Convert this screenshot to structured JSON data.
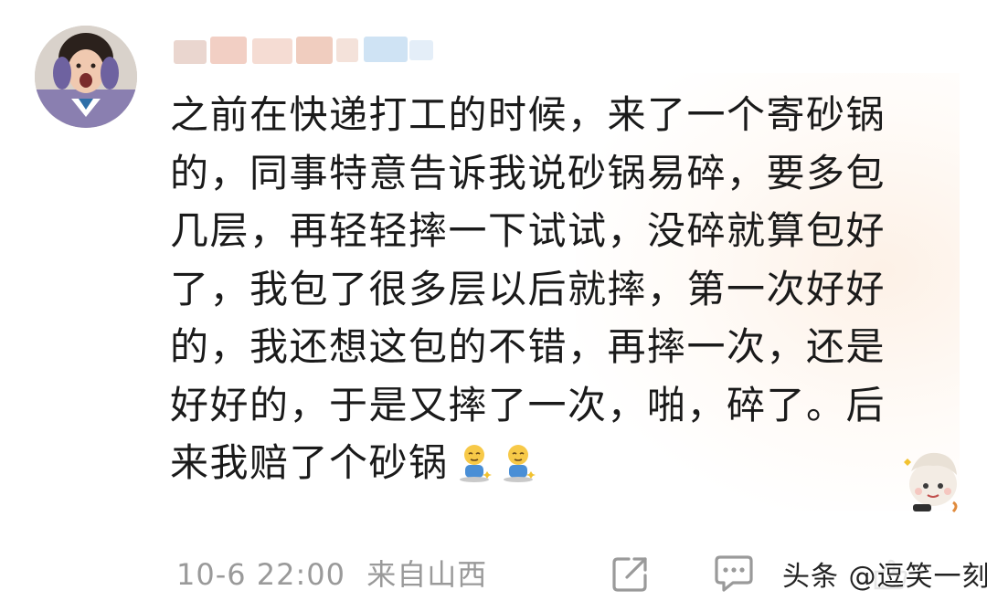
{
  "comment": {
    "lines": [
      "之前在快递打工的时候，来了一个寄砂锅",
      "的，同事特意告诉我说砂锅易碎，要多包",
      "几层，再轻轻摔一下试试，没碎就算包好",
      "了，我包了很多层以后就摔，第一次好好",
      "的，我还想这包的不错，再摔一次，还是",
      "好好的，于是又摔了一次，啪，碎了。后",
      "来我赔了个砂锅"
    ],
    "emojis": [
      "sitting-emoji",
      "sitting-emoji"
    ]
  },
  "meta": {
    "timestamp": "10-6 22:00",
    "source": "来自山西"
  },
  "icons": {
    "share": "share-icon",
    "comment": "comment-icon"
  },
  "watermark": "头条 @逗笑一刻",
  "colors": {
    "text": "#1a1a1a",
    "meta": "#9a9a9a",
    "background": "#ffffff"
  }
}
